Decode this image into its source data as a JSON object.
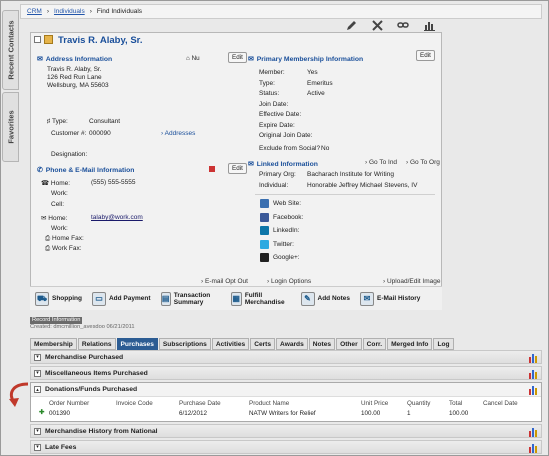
{
  "breadcrumb": {
    "items": [
      "CRM",
      "Individuals",
      "Find Individuals"
    ]
  },
  "side_tabs": [
    "Recent Contacts",
    "Favorites"
  ],
  "contact": {
    "name": "Travis R. Alaby, Sr.",
    "address_title": "Address Information",
    "address_flag": "Nu",
    "address_lines": [
      "Travis R. Alaby, Sr.",
      "126 Red Run Lane",
      "Wellsburg, MA 55603"
    ],
    "type_label": "Type:",
    "type_value": "Consultant",
    "customer_label": "Customer #:",
    "customer_value": "000090",
    "addresses_link": "Addresses",
    "designation_label": "Designation:",
    "edit": "Edit",
    "phone_title": "Phone & E-Mail Information",
    "phones": [
      {
        "label": "Home:",
        "value": "(555) 555-5555"
      },
      {
        "label": "Work:",
        "value": ""
      },
      {
        "label": "Cell:",
        "value": ""
      }
    ],
    "emails": [
      {
        "label": "Home:",
        "value": "talaby@work.com"
      },
      {
        "label": "Work:",
        "value": ""
      },
      {
        "label": "Home Fax:",
        "value": ""
      },
      {
        "label": "Work Fax:",
        "value": ""
      }
    ],
    "email_opt_out": "E-mail Opt Out"
  },
  "membership": {
    "title": "Primary Membership Information",
    "fields": [
      {
        "label": "Member:",
        "value": "Yes"
      },
      {
        "label": "Type:",
        "value": "Emeritus"
      },
      {
        "label": "Status:",
        "value": "Active"
      },
      {
        "label": "Join Date:",
        "value": ""
      },
      {
        "label": "Effective Date:",
        "value": ""
      },
      {
        "label": "Expire Date:",
        "value": ""
      },
      {
        "label": "Original Join Date:",
        "value": ""
      }
    ],
    "exclude_label": "Exclude from Social?",
    "exclude_value": "No"
  },
  "linked": {
    "title": "Linked Information",
    "go_ind": "Go To Ind",
    "go_org": "Go To Org",
    "org_label": "Primary Org:",
    "org_value": "Bacharach Institute for Writing",
    "ind_label": "Individual:",
    "ind_value": "Honorable Jeffrey Michael Stevens, IV",
    "social": [
      "Web Site:",
      "Facebook:",
      "LinkedIn:",
      "Twitter:",
      "Google+:"
    ],
    "login_options": "Login Options",
    "upload_image": "Upload/Edit Image"
  },
  "actions": [
    {
      "label": "Shopping"
    },
    {
      "label": "Add Payment"
    },
    {
      "label": "Transaction Summary"
    },
    {
      "label": "Fulfill Merchandise"
    },
    {
      "label": "Add Notes"
    },
    {
      "label": "E-Mail History"
    }
  ],
  "record": {
    "title": "Record Information",
    "created": "Created: dmcmillion_avesdoo 06/21/2011"
  },
  "tabs": [
    "Membership",
    "Relations",
    "Purchases",
    "Subscriptions",
    "Activities",
    "Certs",
    "Awards",
    "Notes",
    "Other",
    "Corr.",
    "Merged Info",
    "Log"
  ],
  "active_tab": "Purchases",
  "sections": {
    "merchandise": "Merchandise Purchased",
    "misc": "Miscellaneous Items Purchased",
    "donations": "Donations/Funds Purchased",
    "history": "Merchandise History from National",
    "late": "Late Fees"
  },
  "table": {
    "headers": [
      "Order Number",
      "Invoice Code",
      "Purchase Date",
      "Product Name",
      "Unit Price",
      "Quantity",
      "Total",
      "Cancel Date"
    ],
    "rows": [
      [
        "001390",
        "",
        "6/12/2012",
        "NATW Writers for Relief",
        "100.00",
        "1",
        "100.00",
        ""
      ]
    ]
  },
  "colors": {
    "accent": "#1a4f9a",
    "tab_active": "#2c5c93",
    "arrow": "#c0392b"
  }
}
